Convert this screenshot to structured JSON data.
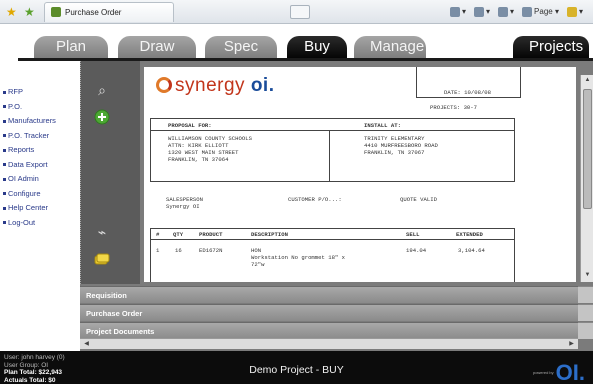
{
  "browser": {
    "tab_title": "Purchase Order",
    "page_menu": "Page",
    "tools": [
      "home-icon",
      "feeds-icon",
      "print-icon",
      "page-icon",
      "tools-icon"
    ]
  },
  "nav": {
    "tabs": [
      {
        "label": "Plan",
        "active": false
      },
      {
        "label": "Draw",
        "active": false
      },
      {
        "label": "Spec",
        "active": false
      },
      {
        "label": "Buy",
        "active": true
      },
      {
        "label": "Manage",
        "active": false
      }
    ],
    "projects_label": "Projects"
  },
  "sidebar": {
    "items": [
      {
        "label": "RFP"
      },
      {
        "label": "P.O."
      },
      {
        "label": "Manufacturers"
      },
      {
        "label": "P.O. Tracker"
      },
      {
        "label": "Reports"
      },
      {
        "label": "Data Export"
      },
      {
        "label": "OI Admin"
      },
      {
        "label": "Configure"
      },
      {
        "label": "Help Center"
      },
      {
        "label": "Log-Out"
      }
    ]
  },
  "document": {
    "company": "synergy",
    "company_suffix": "oi.",
    "invoice_date_label": "DATE:",
    "invoice_date": "10/08/08",
    "projects_label": "PROJECTS:",
    "projects_value": "30-7",
    "proposal_for_label": "PROPOSAL FOR:",
    "install_at_label": "INSTALL AT:",
    "proposal_for": [
      "WILLIAMSON COUNTY SCHOOLS",
      "ATTN: KIRK ELLIOTT",
      "1320 WEST MAIN STREET",
      "FRANKLIN, TN 37064"
    ],
    "install_at": [
      "TRINITY ELEMENTARY",
      "4410 MURFREESBORO ROAD",
      "",
      "FRANKLIN, TN 37067"
    ],
    "salesperson_label": "SALESPERSON",
    "salesperson": "Synergy OI",
    "customer_po_label": "CUSTOMER P/O...:",
    "quote_valid_label": "QUOTE VALID",
    "table_headers": [
      "#",
      "QTY",
      "PRODUCT",
      "DESCRIPTION",
      "SELL",
      "EXTENDED"
    ],
    "rows": [
      {
        "num": "1",
        "qty": "16",
        "product": "ED1672N",
        "desc_line1": "HON",
        "desc_line2": "Workstation No grommet 18\" x",
        "desc_line3": "72\"w",
        "sell": "194.04",
        "extended": "3,104.64"
      }
    ]
  },
  "panels": {
    "requisition": "Requisition",
    "purchase_order": "Purchase Order",
    "project_documents": "Project Documents"
  },
  "footer": {
    "user_line": "User: john harvey (0)",
    "group_line": "User Group: OI",
    "plan_total": "Plan Total: $22,943",
    "actuals_total": "Actuals Total: $0",
    "project_title": "Demo Project - BUY",
    "powered_by": "powered by",
    "brand": "OI."
  }
}
